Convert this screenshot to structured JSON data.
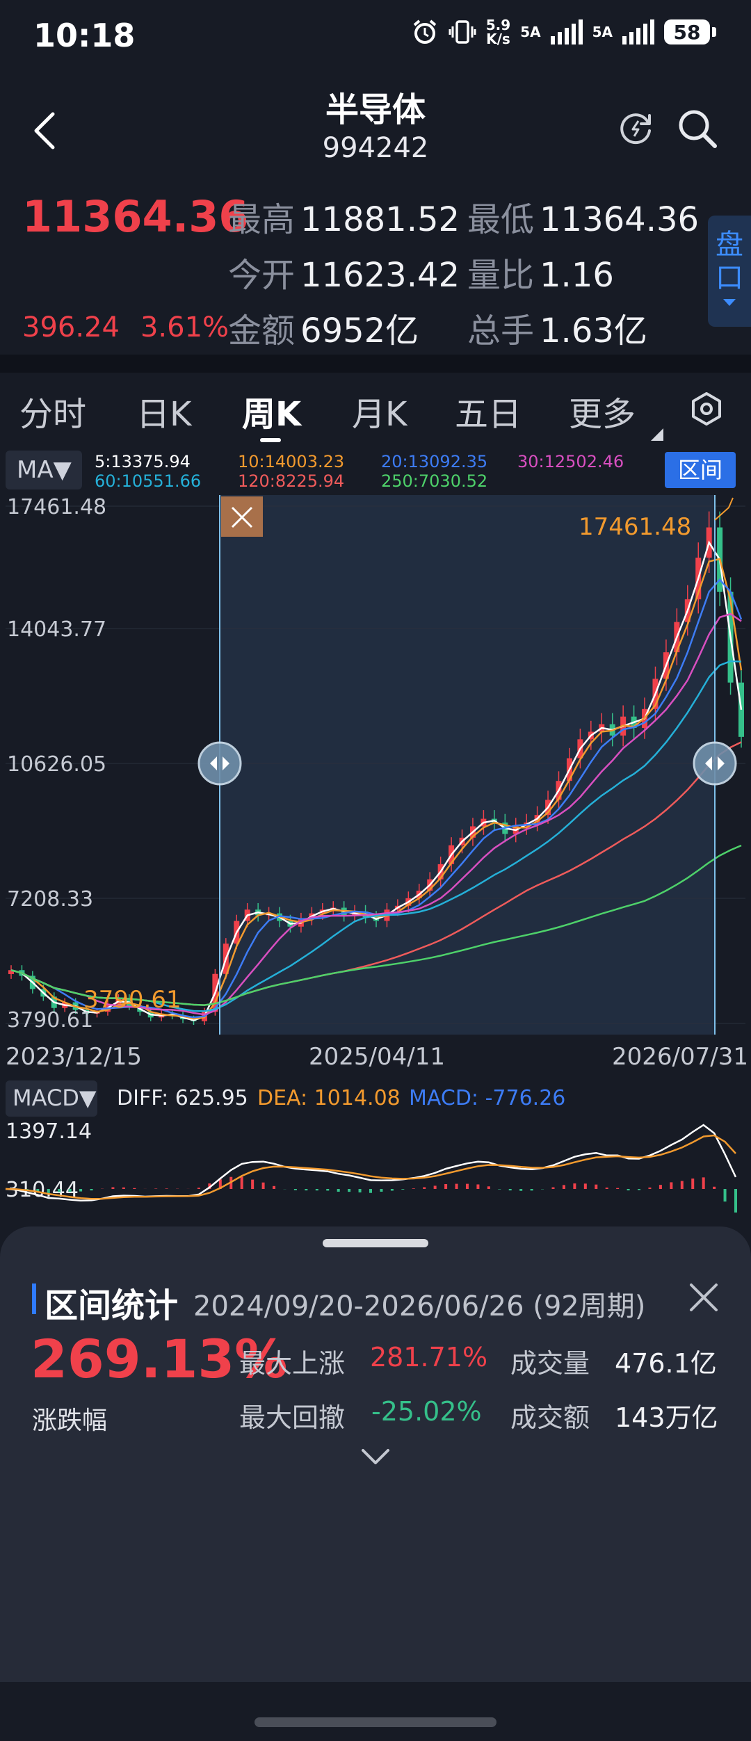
{
  "status": {
    "time": "10:18",
    "net_speed_top": "5.9",
    "net_speed_bottom": "K/s",
    "sim1": "5A",
    "sim2": "5A",
    "battery": "58"
  },
  "header": {
    "title": "半导体",
    "code": "994242"
  },
  "quote": {
    "price": "11364.36",
    "change": "396.24",
    "change_pct": "3.61%",
    "high_label": "最高",
    "high": "11881.52",
    "low_label": "最低",
    "low": "11364.36",
    "open_label": "今开",
    "open": "11623.42",
    "vol_ratio_label": "量比",
    "vol_ratio": "1.16",
    "amount_label": "金额",
    "amount": "6952亿",
    "hands_label": "总手",
    "hands": "1.63亿",
    "pankou_label": "盘口"
  },
  "tabs": [
    {
      "label": "分时"
    },
    {
      "label": "日K"
    },
    {
      "label": "周K"
    },
    {
      "label": "月K"
    },
    {
      "label": "五日"
    },
    {
      "label": "更多"
    }
  ],
  "active_tab": "周K",
  "ma": {
    "button": "MA▼",
    "ma5": "5:13375.94",
    "ma10": "10:14003.23",
    "ma20": "20:13092.35",
    "ma30": "30:12502.46",
    "ma60": "60:10551.66",
    "ma120": "120:8225.94",
    "ma250": "250:7030.52",
    "colors": {
      "ma5": "#ffffff",
      "ma10": "#f29a2e",
      "ma20": "#3d7cf5",
      "ma30": "#d84fc0",
      "ma60": "#25b0d8",
      "ma120": "#ef5b5b",
      "ma250": "#4ed16a"
    }
  },
  "qujian_label": "区间",
  "chart": {
    "y_labels": [
      "17461.48",
      "14043.77",
      "10626.05",
      "7208.33",
      "3790.61"
    ],
    "x_labels": [
      "2023/12/15",
      "2025/04/11",
      "2026/07/31"
    ],
    "max_annotation": "17461.48",
    "min_annotation": "3790.61",
    "up_color": "#f0414b",
    "down_color": "#35c08a"
  },
  "chart_data": {
    "type": "candlestick",
    "title": "",
    "x_range": [
      "2023/12/15",
      "2026/07/31"
    ],
    "ylim": [
      3790.61,
      17461.48
    ],
    "y_ticks": [
      17461.48,
      14043.77,
      10626.05,
      7208.33,
      3790.61
    ],
    "period_high": 17461.48,
    "period_low": 3790.61,
    "series": [
      {
        "name": "5",
        "last": 13375.94
      },
      {
        "name": "10",
        "last": 14003.23
      },
      {
        "name": "20",
        "last": 13092.35
      },
      {
        "name": "30",
        "last": 12502.46
      },
      {
        "name": "60",
        "last": 10551.66
      },
      {
        "name": "120",
        "last": 8225.94
      },
      {
        "name": "250",
        "last": 7030.52
      }
    ],
    "approx_close": [
      5200,
      5050,
      4700,
      4500,
      4200,
      4350,
      4150,
      4050,
      4100,
      4300,
      4450,
      4250,
      4100,
      3950,
      4050,
      4000,
      3900,
      3850,
      4100,
      5100,
      5900,
      6500,
      6800,
      6650,
      6700,
      6500,
      6350,
      6550,
      6700,
      6800,
      6850,
      6650,
      6750,
      6600,
      6500,
      6800,
      6900,
      7100,
      7300,
      7600,
      8000,
      8500,
      8700,
      9000,
      9200,
      9100,
      8800,
      9000,
      9100,
      9300,
      9700,
      10200,
      10800,
      11300,
      11500,
      11700,
      11400,
      11900,
      11600,
      12100,
      12900,
      13600,
      14400,
      15000,
      16100,
      16900,
      15200,
      12800,
      11364
    ]
  },
  "macd": {
    "button": "MACD▼",
    "diff_label": "DIFF: 625.95",
    "dea_label": "DEA: 1014.08",
    "macd_label": "MACD: -776.26",
    "y_top": "1397.14",
    "y_mid": "310.44"
  },
  "stats": {
    "title": "区间统计",
    "range": "2024/09/20-2026/06/26 (92周期)",
    "pct": "269.13%",
    "pct_label": "涨跌幅",
    "max_up_label": "最大上涨",
    "max_up": "281.71%",
    "max_dd_label": "最大回撤",
    "max_dd": "-25.02%",
    "volume_label": "成交量",
    "volume": "476.1亿",
    "turnover_label": "成交额",
    "turnover": "143万亿"
  }
}
